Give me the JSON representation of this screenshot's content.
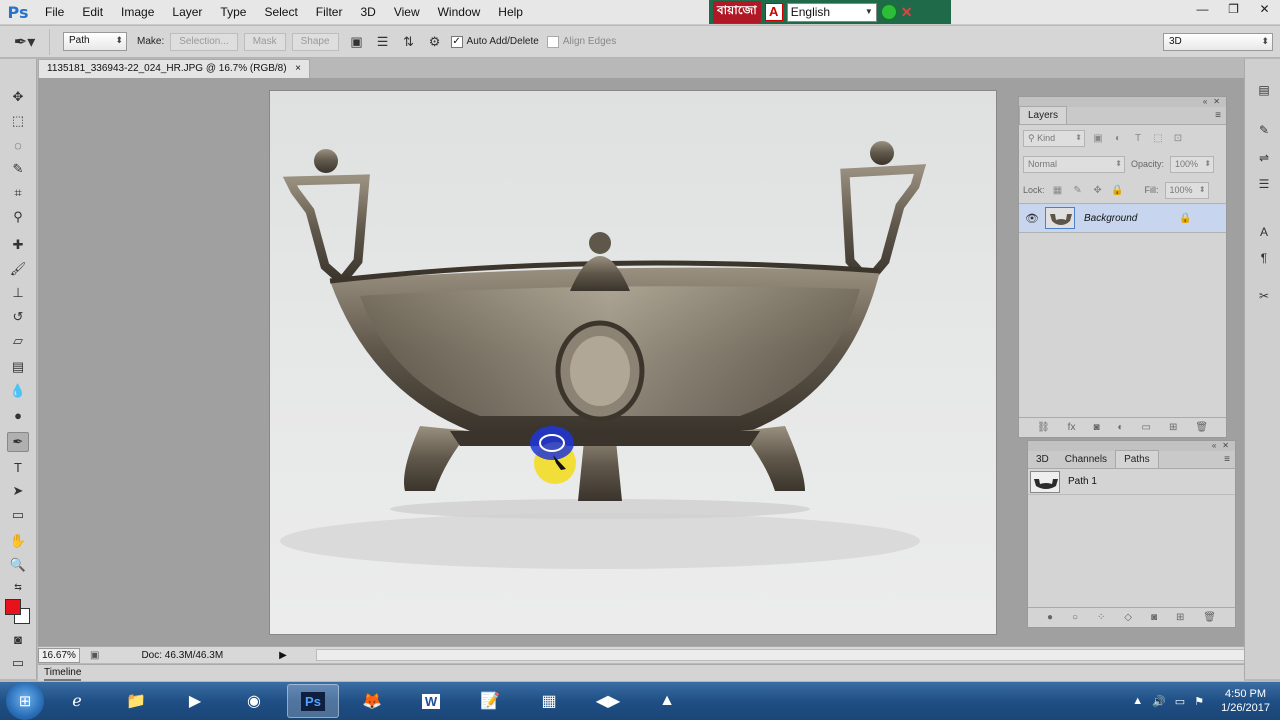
{
  "menubar": {
    "logo": "Ps",
    "items": [
      "File",
      "Edit",
      "Image",
      "Layer",
      "Type",
      "Select",
      "Filter",
      "3D",
      "View",
      "Window",
      "Help"
    ],
    "language_bar": {
      "bangla_label": "বায়াজো",
      "a_label": "A",
      "language": "English"
    },
    "window_buttons": [
      "—",
      "❐",
      "✕"
    ]
  },
  "options": {
    "mode_select": "Path",
    "make_label": "Make:",
    "selection_btn": "Selection...",
    "mask_btn": "Mask",
    "shape_btn": "Shape",
    "auto_add_delete_label": "Auto Add/Delete",
    "auto_add_delete_checked": "✓",
    "align_edges_label": "Align Edges",
    "workspace": "3D"
  },
  "document": {
    "tab_title": "1135181_336943-22_024_HR.JPG @ 16.7% (RGB/8)",
    "tab_close": "×",
    "zoom": "16.67%",
    "doc_size": "Doc: 46.3M/46.3M"
  },
  "timeline": {
    "label": "Timeline"
  },
  "layers_panel": {
    "tab": "Layers",
    "kind_label": "Kind",
    "blend_mode": "Normal",
    "opacity_label": "Opacity:",
    "opacity_value": "100%",
    "lock_label": "Lock:",
    "fill_label": "Fill:",
    "fill_value": "100%",
    "layer_name": "Background"
  },
  "paths_panel": {
    "tabs": [
      "3D",
      "Channels",
      "Paths"
    ],
    "path_name": "Path 1"
  },
  "taskbar": {
    "time": "4:50 PM",
    "date": "1/26/2017"
  },
  "colors": {
    "foreground": "#e8121c",
    "background": "#ffffff",
    "accent": "#2a73c9",
    "layer_selected": "#c7d6ee"
  }
}
